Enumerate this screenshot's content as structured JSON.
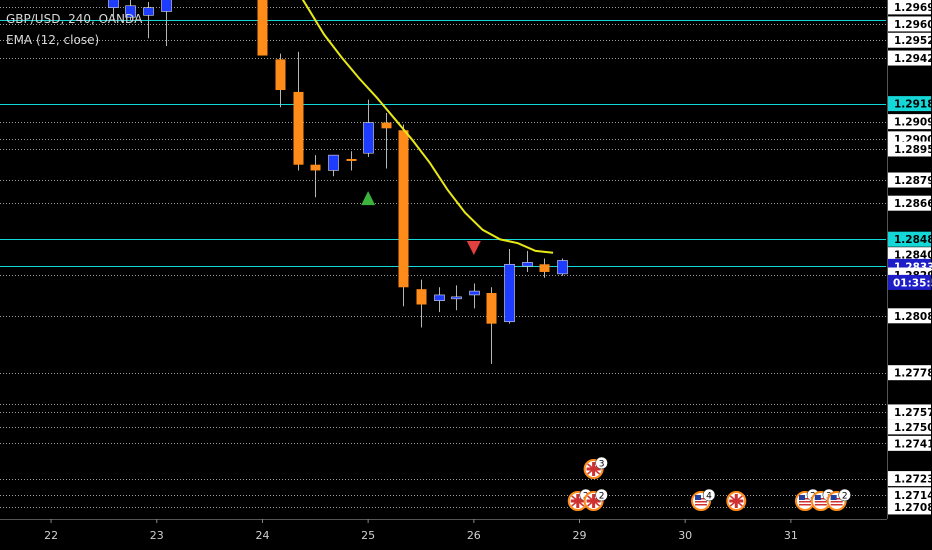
{
  "header": {
    "symbol_line": "GBP/USD, 240, OANDA",
    "indicator_line": "EMA (12, close)"
  },
  "colors": {
    "background": "#000000",
    "bull": "#1e3cff",
    "bear": "#ff8c1a",
    "ema": "#e8e818",
    "hline_cyan": "#14d7d7",
    "hline_dotted": "#9a9a9a",
    "axis_text": "#000000",
    "axis_tag_bg": "#ffffff",
    "last_price_tag_bg": "#1e1ec8",
    "signal_up": "#3cb43c",
    "signal_down": "#e04040"
  },
  "chart_data": {
    "type": "candlestick",
    "symbol": "GBP/USD",
    "timeframe": "240",
    "source": "OANDA",
    "ylim": [
      1.2702,
      1.2973
    ],
    "x_ticks": [
      {
        "label": "22",
        "x": 0
      },
      {
        "label": "23",
        "x": 6
      },
      {
        "label": "24",
        "x": 12
      },
      {
        "label": "25",
        "x": 18
      },
      {
        "label": "26",
        "x": 24
      },
      {
        "label": "29",
        "x": 30
      },
      {
        "label": "30",
        "x": 36
      },
      {
        "label": "31",
        "x": 42
      }
    ],
    "xlim": [
      -2.9,
      47.4
    ],
    "candles": [
      {
        "x": 3.5,
        "o": 1.2969,
        "h": 1.2978,
        "l": 1.2962,
        "c": 1.2974
      },
      {
        "x": 4.5,
        "o": 1.2964,
        "h": 1.2974,
        "l": 1.2962,
        "c": 1.297
      },
      {
        "x": 5.5,
        "o": 1.2965,
        "h": 1.2972,
        "l": 1.2953,
        "c": 1.2969
      },
      {
        "x": 6.5,
        "o": 1.2967,
        "h": 1.2978,
        "l": 1.2949,
        "c": 1.2974
      },
      {
        "x": 12.0,
        "o": 1.2981,
        "h": 1.2985,
        "l": 1.2944,
        "c": 1.2944
      },
      {
        "x": 13.0,
        "o": 1.2942,
        "h": 1.2945,
        "l": 1.2917,
        "c": 1.2926
      },
      {
        "x": 14.0,
        "o": 1.2925,
        "h": 1.2946,
        "l": 1.2884,
        "c": 1.2887
      },
      {
        "x": 15.0,
        "o": 1.2887,
        "h": 1.2892,
        "l": 1.287,
        "c": 1.2884
      },
      {
        "x": 16.0,
        "o": 1.2884,
        "h": 1.2892,
        "l": 1.2881,
        "c": 1.2892
      },
      {
        "x": 17.0,
        "o": 1.289,
        "h": 1.2894,
        "l": 1.2884,
        "c": 1.2889
      },
      {
        "x": 18.0,
        "o": 1.2893,
        "h": 1.2921,
        "l": 1.2891,
        "c": 1.2909
      },
      {
        "x": 19.0,
        "o": 1.2909,
        "h": 1.2914,
        "l": 1.2885,
        "c": 1.2906
      },
      {
        "x": 20.0,
        "o": 1.2905,
        "h": 1.2908,
        "l": 1.2813,
        "c": 1.2823
      },
      {
        "x": 21.0,
        "o": 1.2822,
        "h": 1.2827,
        "l": 1.2802,
        "c": 1.2814
      },
      {
        "x": 22.0,
        "o": 1.2816,
        "h": 1.2823,
        "l": 1.281,
        "c": 1.2819
      },
      {
        "x": 23.0,
        "o": 1.2818,
        "h": 1.2824,
        "l": 1.2811,
        "c": 1.2818
      },
      {
        "x": 24.0,
        "o": 1.2819,
        "h": 1.2825,
        "l": 1.2812,
        "c": 1.2821
      },
      {
        "x": 25.0,
        "o": 1.282,
        "h": 1.2823,
        "l": 1.2783,
        "c": 1.2804
      },
      {
        "x": 26.0,
        "o": 1.2805,
        "h": 1.2843,
        "l": 1.2804,
        "c": 1.2835
      },
      {
        "x": 27.0,
        "o": 1.2834,
        "h": 1.2842,
        "l": 1.2831,
        "c": 1.2836
      },
      {
        "x": 28.0,
        "o": 1.2835,
        "h": 1.2838,
        "l": 1.2828,
        "c": 1.2831
      },
      {
        "x": 29.0,
        "o": 1.283,
        "h": 1.2838,
        "l": 1.2829,
        "c": 1.2837
      }
    ],
    "ema": {
      "name": "EMA (12, close)",
      "points": [
        [
          12.5,
          1.2998
        ],
        [
          13.5,
          1.2985
        ],
        [
          14.5,
          1.297
        ],
        [
          15.5,
          1.2955
        ],
        [
          16.5,
          1.2943
        ],
        [
          17.5,
          1.2932
        ],
        [
          18.5,
          1.2922
        ],
        [
          19.5,
          1.2911
        ],
        [
          20.5,
          1.29
        ],
        [
          21.5,
          1.2888
        ],
        [
          22.5,
          1.2874
        ],
        [
          23.5,
          1.2862
        ],
        [
          24.5,
          1.2853
        ],
        [
          25.5,
          1.2848
        ],
        [
          26.5,
          1.2846
        ],
        [
          27.5,
          1.2842
        ],
        [
          28.5,
          1.2841
        ]
      ]
    },
    "horizontal_lines": [
      {
        "price": 1.29694,
        "label": "1.29694",
        "style": "dotted",
        "tag": "white"
      },
      {
        "price": 1.29625,
        "style": "cyan"
      },
      {
        "price": 1.29605,
        "label": "1.29605",
        "style": "dotted",
        "tag": "white"
      },
      {
        "price": 1.2952,
        "label": "1.29520",
        "style": "dotted",
        "tag": "white"
      },
      {
        "price": 1.29427,
        "label": "1.29427",
        "style": "dotted",
        "tag": "white"
      },
      {
        "price": 1.29189,
        "label": "1.29189",
        "style": "cyan",
        "tag": "cyan"
      },
      {
        "price": 1.29095,
        "label": "1.29095",
        "style": "dotted",
        "tag": "white"
      },
      {
        "price": 1.29005,
        "label": "1.29005",
        "style": "dotted",
        "tag": "white"
      },
      {
        "price": 1.28952,
        "label": "1.28952",
        "style": "dotted",
        "tag": "white"
      },
      {
        "price": 1.2879,
        "label": "1.28790",
        "style": "dotted",
        "tag": "white"
      },
      {
        "price": 1.28669,
        "label": "1.28669",
        "style": "dotted",
        "tag": "white"
      },
      {
        "price": 1.28481,
        "label": "1.28481",
        "style": "cyan",
        "tag": "cyan"
      },
      {
        "price": 1.284,
        "label": "1.28400",
        "style": "none",
        "tag": "white"
      },
      {
        "price": 1.28339,
        "label": "1.28339",
        "style": "cyan",
        "tag": "last"
      },
      {
        "price": 1.28294,
        "label": "1.28294",
        "style": "dotted",
        "tag": "white"
      },
      {
        "price": 1.28081,
        "label": "1.28081",
        "style": "dotted",
        "tag": "white"
      },
      {
        "price": 1.27784,
        "label": "1.27784",
        "style": "dotted",
        "tag": "white"
      },
      {
        "price": 1.2762,
        "style": "dotted"
      },
      {
        "price": 1.27579,
        "label": "1.27579",
        "style": "dotted",
        "tag": "white"
      },
      {
        "price": 1.27501,
        "label": "1.27501",
        "style": "dotted",
        "tag": "white"
      },
      {
        "price": 1.27415,
        "label": "1.27415",
        "style": "dotted",
        "tag": "white"
      },
      {
        "price": 1.27231,
        "label": "1.27231",
        "style": "dotted",
        "tag": "white"
      },
      {
        "price": 1.27146,
        "label": "1.27146",
        "style": "dotted",
        "tag": "white"
      },
      {
        "price": 1.27083,
        "label": "1.27083",
        "style": "dotted",
        "tag": "white"
      }
    ],
    "countdown": "01:35:57",
    "signals": [
      {
        "x": 18.0,
        "price": 1.2869,
        "dir": "up"
      },
      {
        "x": 24.0,
        "price": 1.2844,
        "dir": "down"
      }
    ],
    "events": [
      {
        "x": 30.8,
        "row": 0,
        "flag": "uk-flag-icon",
        "count": "3"
      },
      {
        "x": 29.9,
        "row": 1,
        "flag": "uk-flag-icon",
        "count": "2"
      },
      {
        "x": 30.8,
        "row": 1,
        "flag": "uk-flag-icon",
        "count": "2"
      },
      {
        "x": 36.9,
        "row": 1,
        "flag": "us-flag-icon",
        "count": "4"
      },
      {
        "x": 38.9,
        "row": 1,
        "flag": "uk-flag-icon",
        "count": ""
      },
      {
        "x": 42.8,
        "row": 1,
        "flag": "us-flag-icon",
        "count": "2"
      },
      {
        "x": 43.7,
        "row": 1,
        "flag": "us-flag-icon",
        "count": "3"
      },
      {
        "x": 44.6,
        "row": 1,
        "flag": "us-flag-icon",
        "count": "2"
      }
    ]
  }
}
